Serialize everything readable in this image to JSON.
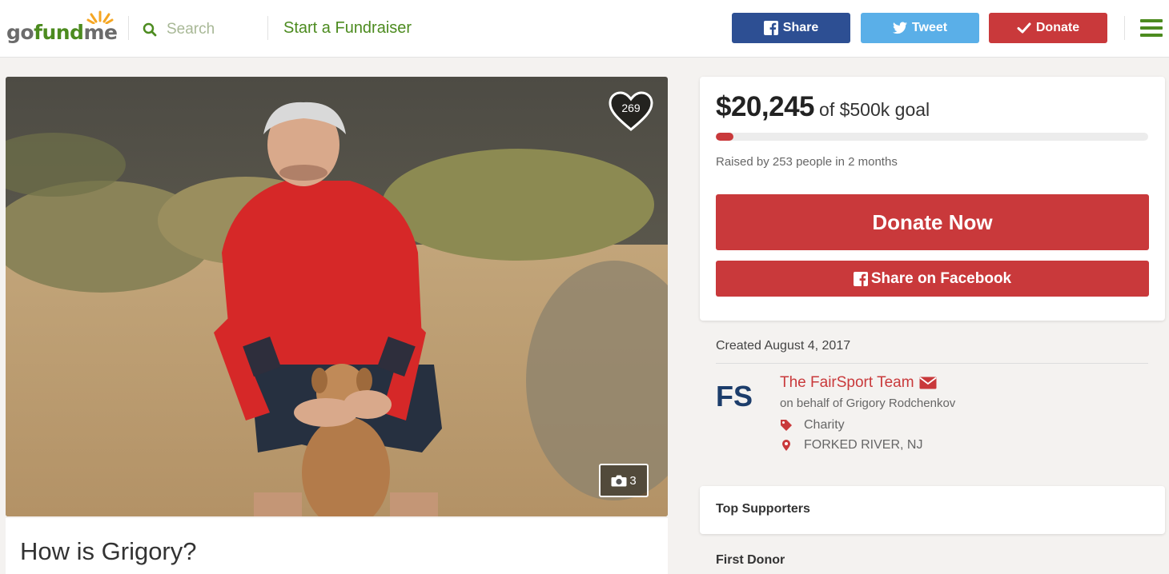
{
  "header": {
    "logo": "gofundme",
    "search_label": "Search",
    "start_label": "Start a Fundraiser",
    "share_label": "Share",
    "tweet_label": "Tweet",
    "donate_label": "Donate"
  },
  "campaign": {
    "heart_count": "269",
    "photo_count": "3",
    "title": "How is Grigory?",
    "amount": "$20,245",
    "goal": "of $500k goal",
    "progress_fraction": 0.04,
    "raised_by": "Raised by 253 people in 2 months",
    "donate_now_label": "Donate Now",
    "share_facebook_label": "Share on Facebook",
    "created": "Created August 4, 2017"
  },
  "organizer": {
    "logo_text": "FS",
    "name": "The FairSport Team",
    "on_behalf": "on behalf of Grigory Rodchenkov",
    "category": "Charity",
    "location": "FORKED RIVER, NJ"
  },
  "sections": {
    "top_supporters": "Top Supporters",
    "first_donor": "First Donor"
  },
  "colors": {
    "brand_green": "#4c8b1f",
    "donate_red": "#c9393b",
    "facebook_blue": "#2d4f93",
    "twitter_blue": "#5aafe8"
  }
}
